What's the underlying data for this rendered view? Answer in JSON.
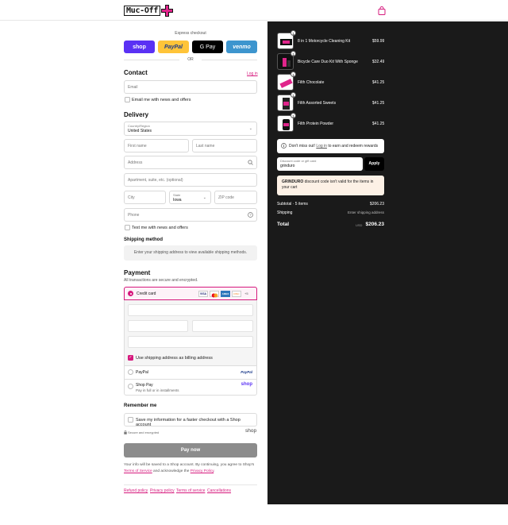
{
  "header": {
    "logo_text": "Muc-Off",
    "cart_icon": "shopping-bag-icon"
  },
  "express": {
    "title": "Express checkout",
    "buttons": [
      {
        "label": "shop",
        "color": "#5a31f4"
      },
      {
        "label": "PayPal",
        "color": "#ffc439"
      },
      {
        "label": "G Pay",
        "color": "#000000"
      },
      {
        "label": "venmo",
        "color": "#3d95ce"
      }
    ],
    "or": "OR"
  },
  "contact": {
    "title": "Contact",
    "login_link": "Log in",
    "email_placeholder": "Email",
    "news_label": "Email me with news and offers"
  },
  "delivery": {
    "title": "Delivery",
    "country_label": "Country/Region",
    "country_value": "United States",
    "first_name": "First name",
    "last_name": "Last name",
    "address": "Address",
    "apartment": "Apartment, suite, etc. (optional)",
    "city": "City",
    "state_label": "State",
    "state_value": "Iowa",
    "zip": "ZIP code",
    "phone": "Phone",
    "text_news": "Text me with news and offers"
  },
  "shipping_method": {
    "title": "Shipping method",
    "notice": "Enter your shipping address to view available shipping methods."
  },
  "payment": {
    "title": "Payment",
    "subtitle": "All transactions are secure and encrypted.",
    "credit_card": "Credit card",
    "card_brands": [
      "VISA",
      "MC",
      "AMEX",
      "DISC",
      "+5"
    ],
    "billing_label": "Use shipping address as billing address",
    "paypal": "PayPal",
    "paypal_logo": "PayPal",
    "shop_pay": "Shop Pay",
    "shop_pay_sub": "Pay in full or in installments",
    "shop_pay_logo": "shop"
  },
  "remember": {
    "title": "Remember me",
    "checkbox_label": "Save my information for a faster checkout with a Shop account",
    "secure": "Secure and encrypted",
    "shop_logo": "shop"
  },
  "pay_button": "Pay now",
  "legal": {
    "line1": "Your info will be saved to a Shop account. By continuing, you agree to Shop's",
    "tos": "Terms of Service",
    "mid": " and acknowledge the ",
    "privacy": "Privacy Policy",
    "end": "."
  },
  "footer_links": [
    "Refund policy",
    "Privacy policy",
    "Terms of service",
    "Cancellations"
  ],
  "cart": {
    "items": [
      {
        "name": "8 in 1 Motorcycle Cleaning Kit",
        "price": "$59.99",
        "qty": "1"
      },
      {
        "name": "Bicycle Care Duo Kit With Sponge",
        "price": "$32.49",
        "qty": "1"
      },
      {
        "name": "Filth Chocolate",
        "price": "$41.25",
        "qty": "1"
      },
      {
        "name": "Filth Assorted Sweets",
        "price": "$41.25",
        "qty": "1"
      },
      {
        "name": "Filth Protein Powder",
        "price": "$41.25",
        "qty": "1"
      }
    ],
    "login_notice_pre": "Don't miss out! ",
    "login_notice_link": "Log in",
    "login_notice_post": " to earn and redeem rewards",
    "discount_label": "Discount code or gift card",
    "discount_value": "grinduro",
    "apply": "Apply",
    "discount_error_code": "GRINDURO",
    "discount_error_msg": " discount code isn't valid for the items in your cart",
    "subtotal_label": "Subtotal · 5 items",
    "subtotal_value": "$206.23",
    "shipping_label": "Shipping",
    "shipping_value": "Enter shipping address",
    "total_label": "Total",
    "currency": "USD",
    "total_value": "$206.23"
  },
  "colors": {
    "accent": "#d6197d",
    "right_bg": "#1a1a1a",
    "pay_button": "#8c8c8c"
  }
}
